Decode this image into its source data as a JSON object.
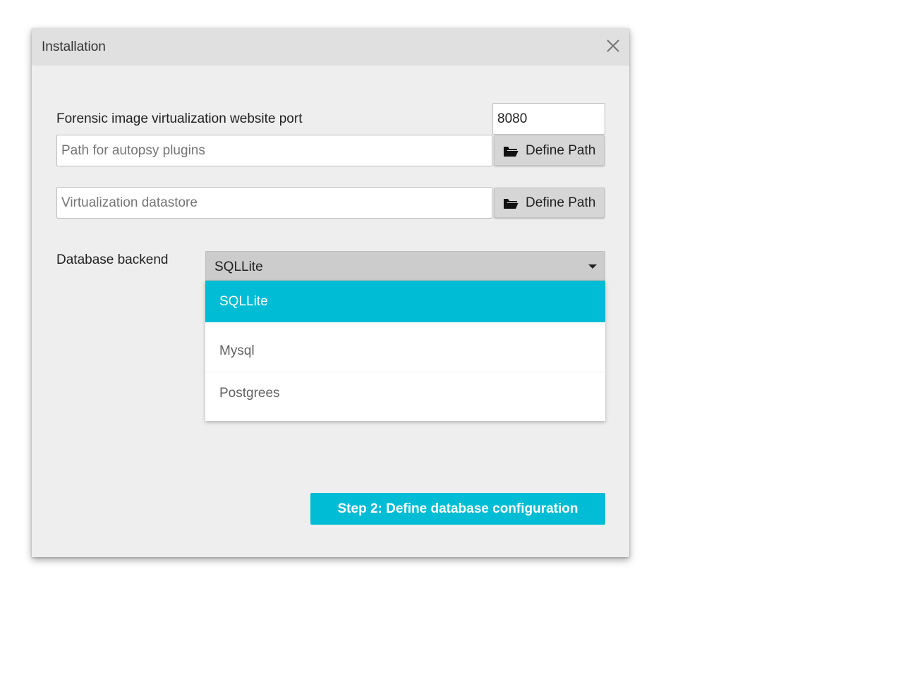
{
  "dialog": {
    "title": "Installation",
    "close_icon": "close-icon"
  },
  "form": {
    "port_label": "Forensic image virtualization website port",
    "port_value": "8080",
    "plugins_path_placeholder": "Path for autopsy plugins",
    "datastore_placeholder": "Virtualization datastore",
    "define_path_label": "Define Path",
    "define_path_icon": "folder-open-icon",
    "database_label": "Database backend",
    "database_selected": "SQLLite",
    "database_options": [
      "SQLLite",
      "Mysql",
      "Postgrees"
    ]
  },
  "actions": {
    "next_label": "Step 2: Define database configuration"
  },
  "colors": {
    "accent": "#00bcd4",
    "dialog_bg": "#eeeeee",
    "titlebar_bg": "#e0e0e0",
    "select_bg": "#cccccc"
  }
}
